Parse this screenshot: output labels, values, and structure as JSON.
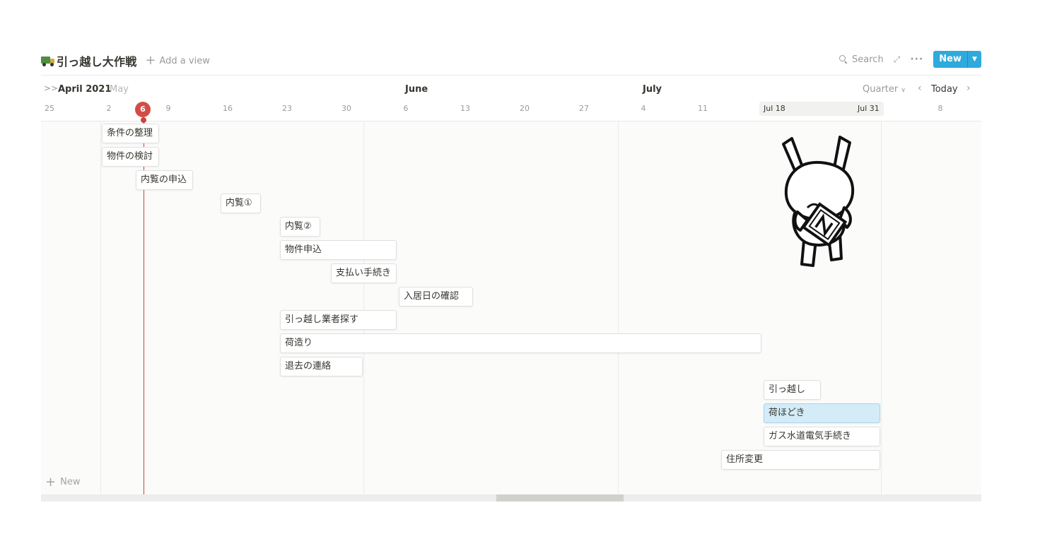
{
  "header": {
    "title": "引っ越し大作戦",
    "title_icon": "truck-icon",
    "add_view_label": "Add a view",
    "search_label": "Search",
    "new_label": "New",
    "accent_color": "#2eaadc"
  },
  "timeline": {
    "months": {
      "april": "April 2021",
      "may": "May",
      "june": "June",
      "july": "July"
    },
    "zoom_label": "Quarter",
    "today_label": "Today",
    "today_marker": "6",
    "today_color": "#d44c47",
    "days": [
      "25",
      "2",
      "9",
      "16",
      "23",
      "30",
      "6",
      "13",
      "20",
      "27",
      "4",
      "11",
      "8"
    ],
    "range_start": "Jul 18",
    "range_end": "Jul 31"
  },
  "tasks": [
    "条件の整理",
    "物件の検討",
    "内覧の申込",
    "内覧①",
    "内覧②",
    "物件申込",
    "支払い手続き",
    "入居日の確認",
    "引っ越し業者探す",
    "荷造り",
    "退去の連絡",
    "引っ越し",
    "荷ほどき",
    "ガス水道電気手続き",
    "住所変更"
  ],
  "selected_task": "荷ほどき",
  "new_row_label": "New",
  "illustration": "rabbit-holding-notion-cube"
}
